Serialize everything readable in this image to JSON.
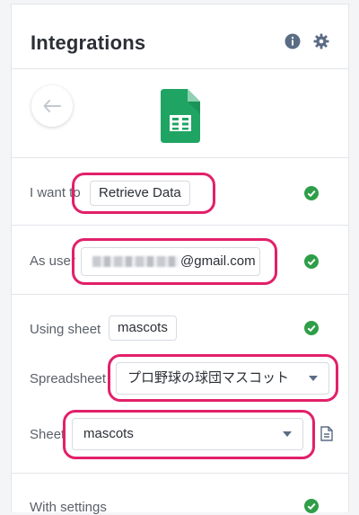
{
  "header": {
    "title": "Integrations",
    "info_icon": "info-icon",
    "settings_icon": "gear-icon"
  },
  "app": {
    "back_icon": "arrow-left-icon",
    "logo": "google-sheets-icon"
  },
  "rows": {
    "i_want_to": {
      "label": "I want to",
      "value": "Retrieve Data",
      "status": "check-icon"
    },
    "as_user": {
      "label": "As user",
      "value": "@gmail.com",
      "status": "check-icon"
    },
    "using_sheet": {
      "label": "Using sheet",
      "value": "mascots",
      "status": "check-icon"
    },
    "spreadsheet": {
      "label": "Spreadsheet",
      "value": "プロ野球の球団マスコット"
    },
    "sheet": {
      "label": "Sheet",
      "value": "mascots",
      "extra_icon": "document-icon"
    },
    "with_settings": {
      "label": "With settings",
      "status": "check-icon"
    }
  },
  "colors": {
    "highlight": "#e2206a",
    "check": "#2e9e48",
    "sheets_green": "#1fa463"
  }
}
